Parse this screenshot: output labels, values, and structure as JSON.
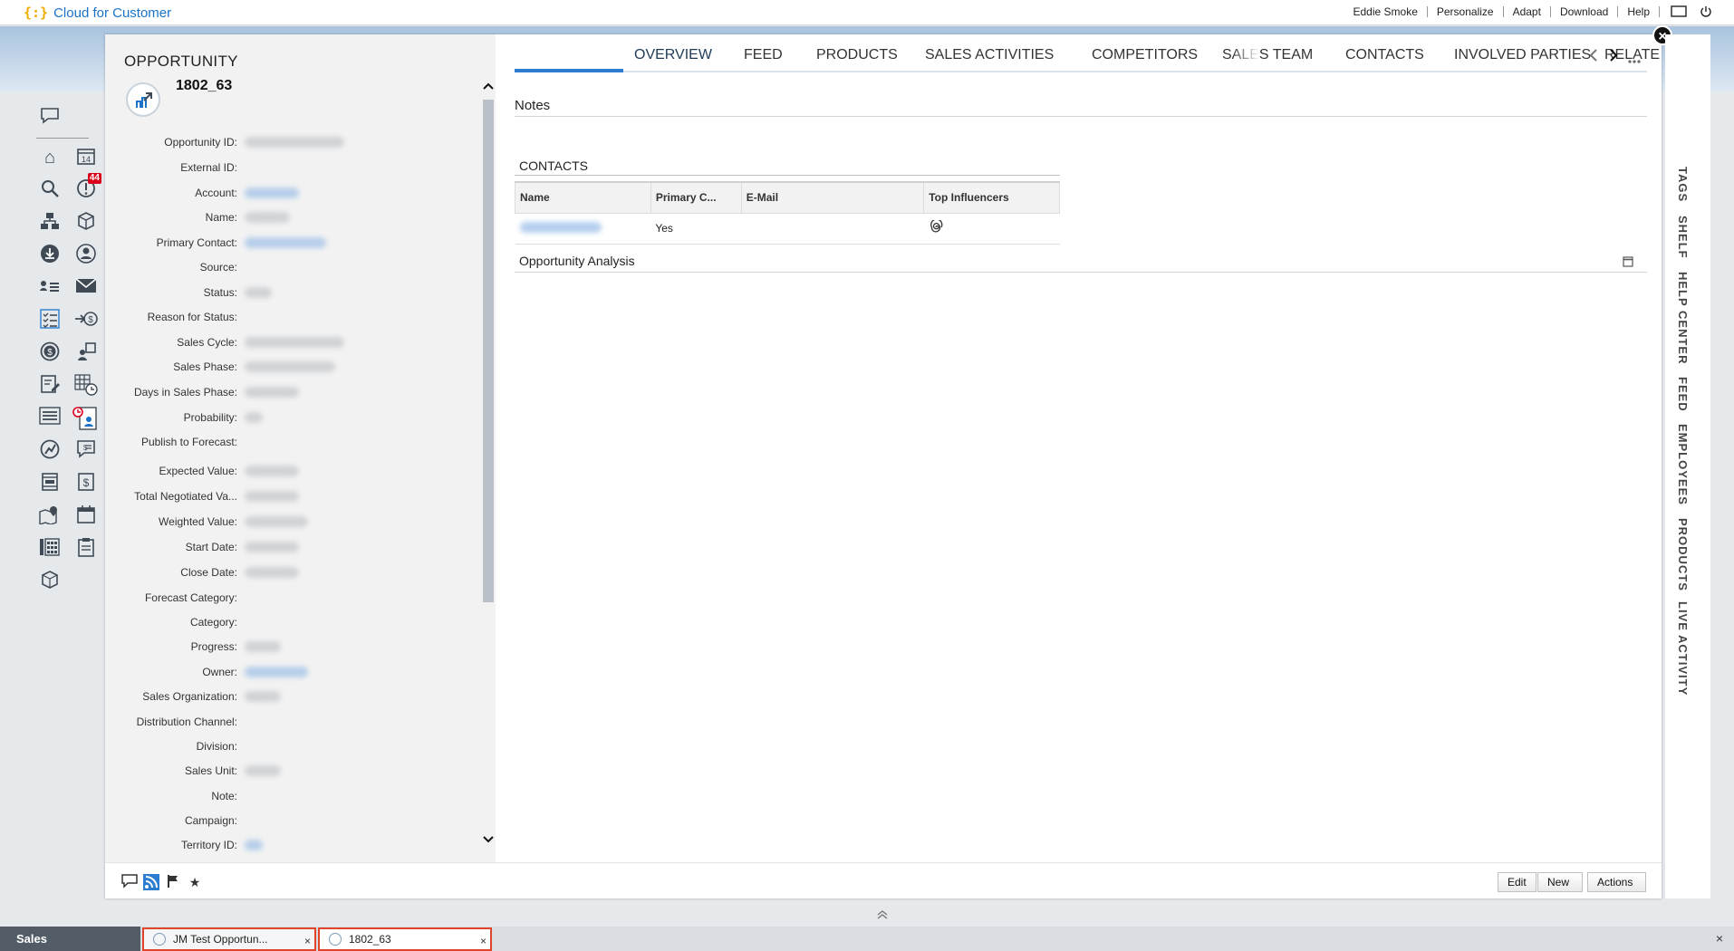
{
  "topbar": {
    "brand_logo": "{:}",
    "brand_name": "Cloud for Customer",
    "user": "Eddie Smoke",
    "links": [
      "Personalize",
      "Adapt",
      "Download",
      "Help"
    ]
  },
  "rail": {
    "badge_count": "44",
    "calendar_day": "14"
  },
  "left_pane": {
    "object_type": "OPPORTUNITY",
    "object_id": "1802_63",
    "fields": [
      {
        "label": "Opportunity ID:"
      },
      {
        "label": "External ID:"
      },
      {
        "label": "Account:"
      },
      {
        "label": "Name:"
      },
      {
        "label": "Primary Contact:"
      },
      {
        "label": "Source:"
      },
      {
        "label": "Status:"
      },
      {
        "label": "Reason for Status:"
      },
      {
        "label": "Sales Cycle:"
      },
      {
        "label": "Sales Phase:"
      },
      {
        "label": "Days in Sales Phase:"
      },
      {
        "label": "Probability:"
      },
      {
        "label": "Publish to Forecast:"
      },
      {
        "label": "Expected Value:"
      },
      {
        "label": "Total Negotiated Va..."
      },
      {
        "label": "Weighted Value:"
      },
      {
        "label": "Start Date:"
      },
      {
        "label": "Close Date:"
      },
      {
        "label": "Forecast Category:"
      },
      {
        "label": "Category:"
      },
      {
        "label": "Progress:"
      },
      {
        "label": "Owner:"
      },
      {
        "label": "Sales Organization:"
      },
      {
        "label": "Distribution Channel:"
      },
      {
        "label": "Division:"
      },
      {
        "label": "Sales Unit:"
      },
      {
        "label": "Note:"
      },
      {
        "label": "Campaign:"
      },
      {
        "label": "Territory ID:"
      }
    ]
  },
  "tabs": [
    "OVERVIEW",
    "FEED",
    "PRODUCTS",
    "SALES ACTIVITIES",
    "COMPETITORS",
    "SALES TEAM",
    "CONTACTS",
    "INVOLVED PARTIES",
    "RELATE"
  ],
  "overview": {
    "notes_title": "Notes",
    "contacts_title": "CONTACTS",
    "contacts_columns": [
      "Name",
      "Primary C...",
      "E-Mail",
      "Top Influencers"
    ],
    "contacts_rows": [
      {
        "primary": "Yes",
        "email": ""
      }
    ],
    "analysis_title": "Opportunity Analysis"
  },
  "buttons": {
    "edit": "Edit",
    "new": "New",
    "actions": "Actions"
  },
  "side_tabs": [
    "TAGS",
    "SHELF",
    "HELP CENTER",
    "FEED",
    "EMPLOYEES",
    "PRODUCTS",
    "LIVE ACTIVITY"
  ],
  "bottombar": {
    "workcenter": "Sales",
    "tabs": [
      "JM Test Opportun...",
      "1802_63"
    ]
  },
  "colors": {
    "accent": "#2a7dd1",
    "brand": "#1a73c8",
    "highlight_border": "#e0442a",
    "badge": "#d9001b"
  }
}
